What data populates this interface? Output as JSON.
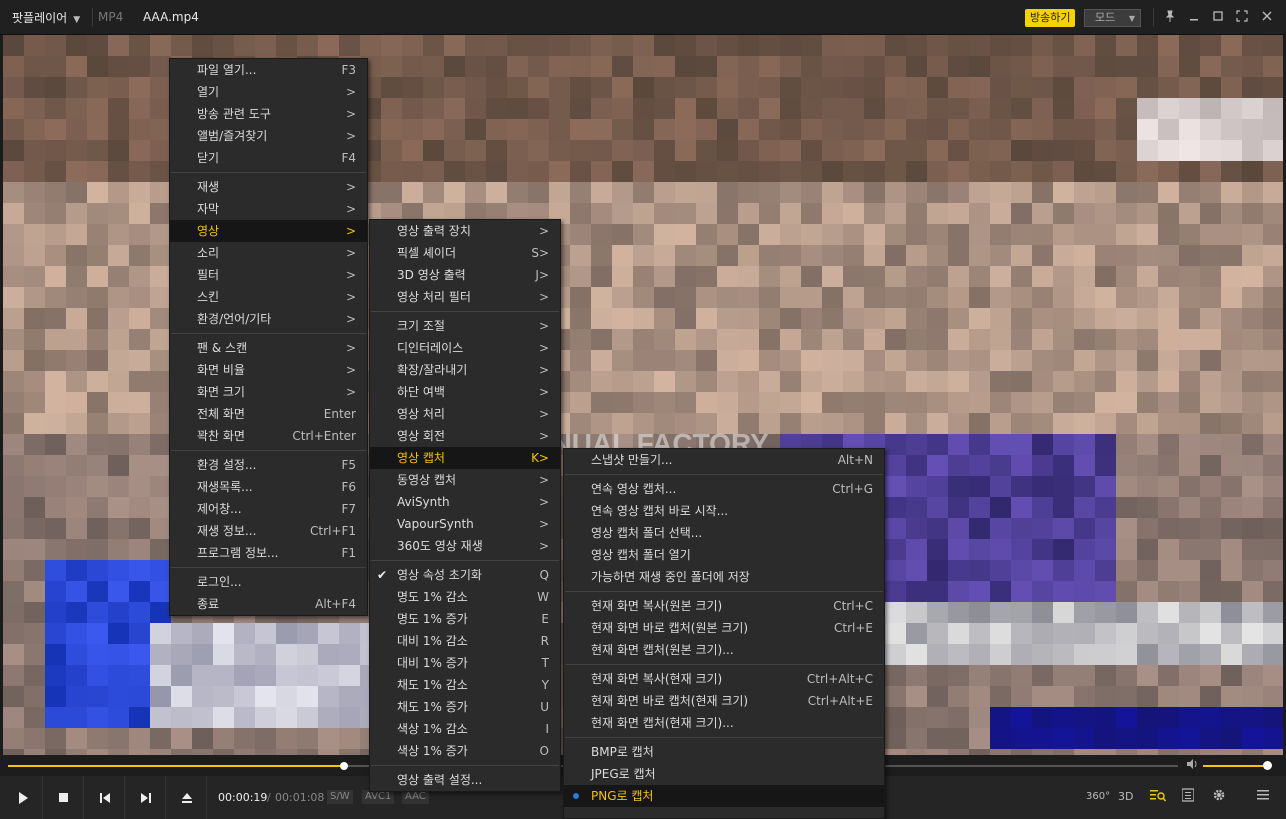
{
  "titlebar": {
    "app_name": "팟플레이어",
    "format": "MP4",
    "file_name": "AAA.mp4",
    "broadcast_button": "방송하기",
    "mode_select": "모드"
  },
  "video": {
    "watermark": "MANUAL FACTORY"
  },
  "seekbar": {
    "progress": 0.287,
    "volume": 0.92
  },
  "controls": {
    "current_time": "00:00:19",
    "separator": "/",
    "total_time": "00:01:08",
    "badges": [
      "S/W",
      "AVC1",
      "AAC"
    ],
    "right_buttons": {
      "vr360": "360°",
      "three_d": "3D"
    }
  },
  "main_menu": {
    "groups": [
      [
        {
          "label": "파일 열기...",
          "shortcut": "F3"
        },
        {
          "label": "열기",
          "shortcut": ">"
        },
        {
          "label": "방송 관련 도구",
          "shortcut": ">"
        },
        {
          "label": "앨범/즐겨찾기",
          "shortcut": ">"
        },
        {
          "label": "닫기",
          "shortcut": "F4"
        }
      ],
      [
        {
          "label": "재생",
          "shortcut": ">"
        },
        {
          "label": "자막",
          "shortcut": ">"
        },
        {
          "label": "영상",
          "shortcut": ">",
          "active": true
        },
        {
          "label": "소리",
          "shortcut": ">"
        },
        {
          "label": "필터",
          "shortcut": ">"
        },
        {
          "label": "스킨",
          "shortcut": ">"
        },
        {
          "label": "환경/언어/기타",
          "shortcut": ">"
        }
      ],
      [
        {
          "label": "팬 & 스캔",
          "shortcut": ">"
        },
        {
          "label": "화면 비율",
          "shortcut": ">"
        },
        {
          "label": "화면 크기",
          "shortcut": ">"
        },
        {
          "label": "전체 화면",
          "shortcut": "Enter"
        },
        {
          "label": "꽉찬 화면",
          "shortcut": "Ctrl+Enter"
        }
      ],
      [
        {
          "label": "환경 설정...",
          "shortcut": "F5"
        },
        {
          "label": "재생목록...",
          "shortcut": "F6"
        },
        {
          "label": "제어창...",
          "shortcut": "F7"
        },
        {
          "label": "재생 정보...",
          "shortcut": "Ctrl+F1"
        },
        {
          "label": "프로그램 정보...",
          "shortcut": "F1"
        }
      ],
      [
        {
          "label": "로그인...",
          "shortcut": ""
        },
        {
          "label": "종료",
          "shortcut": "Alt+F4"
        }
      ]
    ]
  },
  "video_menu": {
    "groups": [
      [
        {
          "label": "영상 출력 장치",
          "shortcut": ">"
        },
        {
          "label": "픽셀 셰이더",
          "shortcut": "S>"
        },
        {
          "label": "3D 영상 출력",
          "shortcut": "J>"
        },
        {
          "label": "영상 처리 필터",
          "shortcut": ">"
        }
      ],
      [
        {
          "label": "크기 조절",
          "shortcut": ">"
        },
        {
          "label": "디인터레이스",
          "shortcut": ">"
        },
        {
          "label": "확장/잘라내기",
          "shortcut": ">"
        },
        {
          "label": "하단 여백",
          "shortcut": ">"
        },
        {
          "label": "영상 처리",
          "shortcut": ">"
        },
        {
          "label": "영상 회전",
          "shortcut": ">"
        },
        {
          "label": "영상 캡처",
          "shortcut": "K>",
          "active": true
        },
        {
          "label": "동영상 캡처",
          "shortcut": ">"
        },
        {
          "label": "AviSynth",
          "shortcut": ">"
        },
        {
          "label": "VapourSynth",
          "shortcut": ">"
        },
        {
          "label": "360도 영상 재생",
          "shortcut": ">"
        }
      ],
      [
        {
          "label": "영상 속성 초기화",
          "shortcut": "Q",
          "checked": true
        },
        {
          "label": "명도 1% 감소",
          "shortcut": "W"
        },
        {
          "label": "명도 1% 증가",
          "shortcut": "E"
        },
        {
          "label": "대비 1% 감소",
          "shortcut": "R"
        },
        {
          "label": "대비 1% 증가",
          "shortcut": "T"
        },
        {
          "label": "채도 1% 감소",
          "shortcut": "Y"
        },
        {
          "label": "채도 1% 증가",
          "shortcut": "U"
        },
        {
          "label": "색상 1% 감소",
          "shortcut": "I"
        },
        {
          "label": "색상 1% 증가",
          "shortcut": "O"
        }
      ],
      [
        {
          "label": "영상 출력 설정...",
          "shortcut": ""
        }
      ]
    ]
  },
  "capture_menu": {
    "groups": [
      [
        {
          "label": "스냅샷 만들기...",
          "shortcut": "Alt+N"
        }
      ],
      [
        {
          "label": "연속 영상 캡처...",
          "shortcut": "Ctrl+G"
        },
        {
          "label": "연속 영상 캡처 바로 시작...",
          "shortcut": ""
        },
        {
          "label": "영상 캡처 폴더 선택...",
          "shortcut": ""
        },
        {
          "label": "영상 캡처 폴더 열기",
          "shortcut": ""
        },
        {
          "label": "가능하면 재생 중인 폴더에 저장",
          "shortcut": ""
        }
      ],
      [
        {
          "label": "현재 화면 복사(원본 크기)",
          "shortcut": "Ctrl+C"
        },
        {
          "label": "현재 화면 바로 캡처(원본 크기)",
          "shortcut": "Ctrl+E"
        },
        {
          "label": "현재 화면 캡처(원본 크기)...",
          "shortcut": ""
        }
      ],
      [
        {
          "label": "현재 화면 복사(현재 크기)",
          "shortcut": "Ctrl+Alt+C"
        },
        {
          "label": "현재 화면 바로 캡처(현재 크기)",
          "shortcut": "Ctrl+Alt+E"
        },
        {
          "label": "현재 화면 캡처(현재 크기)...",
          "shortcut": ""
        }
      ],
      [
        {
          "label": "BMP로 캡처",
          "shortcut": ""
        },
        {
          "label": "JPEG로 캡처",
          "shortcut": ""
        },
        {
          "label": "PNG로 캡처",
          "shortcut": "",
          "active": true,
          "radio": true
        }
      ]
    ]
  }
}
